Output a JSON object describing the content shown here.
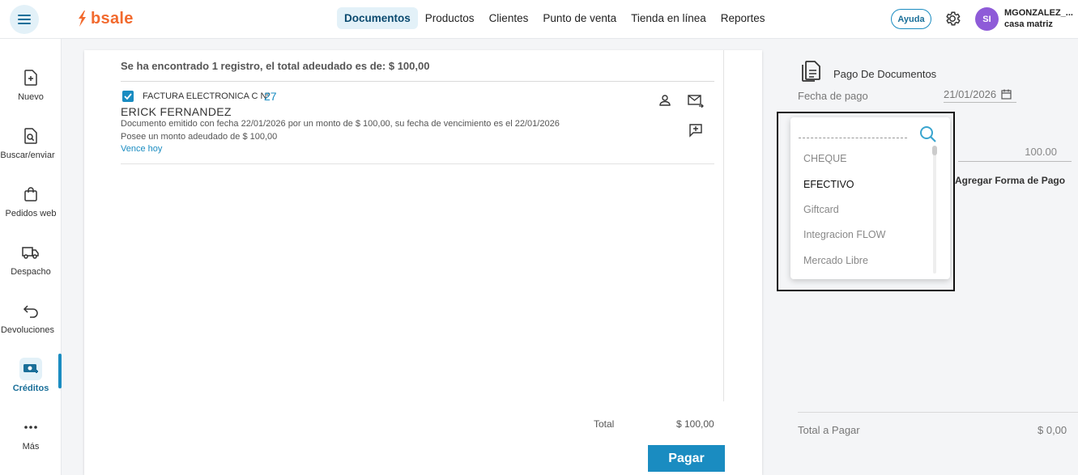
{
  "topbar": {
    "logo": "bsale",
    "nav": [
      "Documentos",
      "Productos",
      "Clientes",
      "Punto de venta",
      "Tienda en línea",
      "Reportes"
    ],
    "active_nav": "Documentos",
    "help_label": "Ayuda",
    "avatar_initials": "SI",
    "user_name": "MGONZALEZ_...",
    "branch": "casa matriz"
  },
  "sidebar": {
    "items": [
      {
        "label": "Nuevo",
        "icon": "new-document-icon"
      },
      {
        "label": "Buscar/enviar",
        "icon": "search-document-icon"
      },
      {
        "label": "Pedidos web",
        "icon": "shopping-bag-icon"
      },
      {
        "label": "Despacho",
        "icon": "truck-icon"
      },
      {
        "label": "Devoluciones",
        "icon": "return-arrow-icon"
      },
      {
        "label": "Créditos",
        "icon": "credits-icon"
      },
      {
        "label": "Más",
        "icon": "more-dots-icon"
      }
    ],
    "active": "Créditos"
  },
  "main": {
    "summary": "Se ha encontrado 1 registro, el total adeudado es de: $ 100,00",
    "document": {
      "type": "FACTURA ELECTRONICA C Nº",
      "number": "27",
      "client": "ERICK FERNANDEZ",
      "description": "Documento emitido con fecha 22/01/2026 por un monto de $ 100,00, su fecha de vencimiento es el 22/01/2026",
      "owed": "Posee un monto adeudado de $ 100,00",
      "due": "Vence hoy",
      "checked": true
    },
    "total_label": "Total",
    "total_value": "$ 100,00",
    "pay_button": "Pagar"
  },
  "payment_panel": {
    "title": "Pago De Documentos",
    "date_label": "Fecha de pago",
    "date_value": "21/01/2026",
    "amount_value": "100.00",
    "add_method": "Agregar Forma de Pago",
    "total_label": "Total a Pagar",
    "total_value": "$ 0,00"
  },
  "dropdown": {
    "search_placeholder": "",
    "options": [
      "CHEQUE",
      "EFECTIVO",
      "Giftcard",
      "Integracion FLOW",
      "Mercado Libre"
    ],
    "selected": "EFECTIVO"
  },
  "colors": {
    "accent": "#1a8cc1",
    "brand": "#f26a2e",
    "avatar": "#8e5bd8"
  }
}
